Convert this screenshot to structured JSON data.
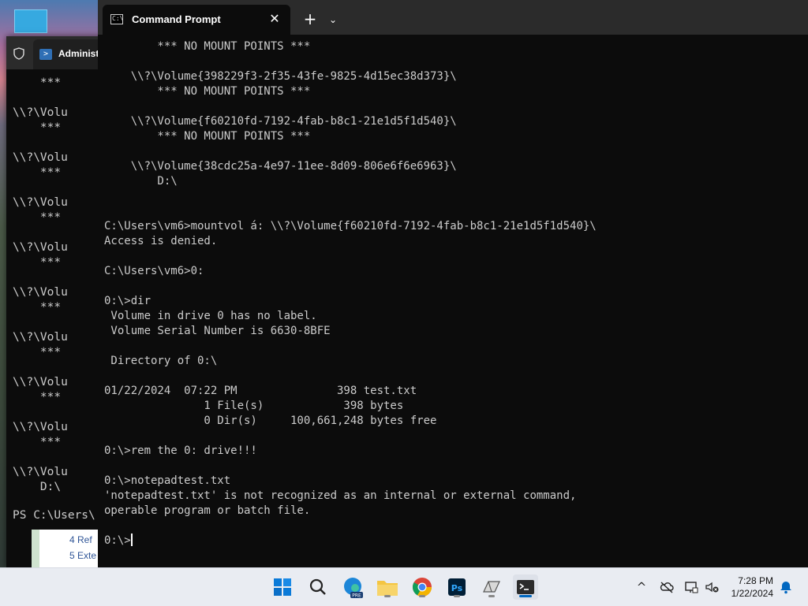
{
  "powershell": {
    "tab_title": "Administ",
    "lines": [
      "    ***",
      "",
      "\\\\?\\Volu",
      "    ***",
      "",
      "\\\\?\\Volu",
      "    ***",
      "",
      "\\\\?\\Volu",
      "    ***",
      "",
      "\\\\?\\Volu",
      "    ***",
      "",
      "\\\\?\\Volu",
      "    ***",
      "",
      "\\\\?\\Volu",
      "    ***",
      "",
      "\\\\?\\Volu",
      "    ***",
      "",
      "\\\\?\\Volu",
      "    ***",
      "",
      "\\\\?\\Volu",
      "    D:\\"
    ],
    "prompt": "PS C:\\Users\\"
  },
  "word_doc": {
    "lines": [
      "4  Ref",
      "5  Exte"
    ]
  },
  "cmd": {
    "tab_title": "Command Prompt",
    "close_glyph": "✕",
    "new_tab_glyph": "+",
    "dropdown_glyph": "⌄",
    "lines": [
      "        *** NO MOUNT POINTS ***",
      "",
      "    \\\\?\\Volume{398229f3-2f35-43fe-9825-4d15ec38d373}\\",
      "        *** NO MOUNT POINTS ***",
      "",
      "    \\\\?\\Volume{f60210fd-7192-4fab-b8c1-21e1d5f1d540}\\",
      "        *** NO MOUNT POINTS ***",
      "",
      "    \\\\?\\Volume{38cdc25a-4e97-11ee-8d09-806e6f6e6963}\\",
      "        D:\\",
      "",
      "",
      "C:\\Users\\vm6>mountvol á: \\\\?\\Volume{f60210fd-7192-4fab-b8c1-21e1d5f1d540}\\",
      "Access is denied.",
      "",
      "C:\\Users\\vm6>0:",
      "",
      "0:\\>dir",
      " Volume in drive 0 has no label.",
      " Volume Serial Number is 6630-8BFE",
      "",
      " Directory of 0:\\",
      "",
      "01/22/2024  07:22 PM               398 test.txt",
      "               1 File(s)            398 bytes",
      "               0 Dir(s)     100,661,248 bytes free",
      "",
      "0:\\>rem the 0: drive!!!",
      "",
      "0:\\>notepadtest.txt",
      "'notepadtest.txt' is not recognized as an internal or external command,",
      "operable program or batch file.",
      ""
    ],
    "prompt": "0:\\>"
  },
  "taskbar": {
    "apps": [
      "start",
      "search",
      "edge-beta",
      "file-explorer",
      "chrome",
      "photoshop",
      "app-store-like",
      "terminal"
    ],
    "time": "7:28 PM",
    "date": "1/22/2024"
  },
  "colors": {
    "terminal_bg": "#0c0c0c",
    "terminal_fg": "#cccccc",
    "titlebar": "#2b2b2b",
    "taskbar": "#e9ecf2",
    "accent": "#0067c0"
  }
}
